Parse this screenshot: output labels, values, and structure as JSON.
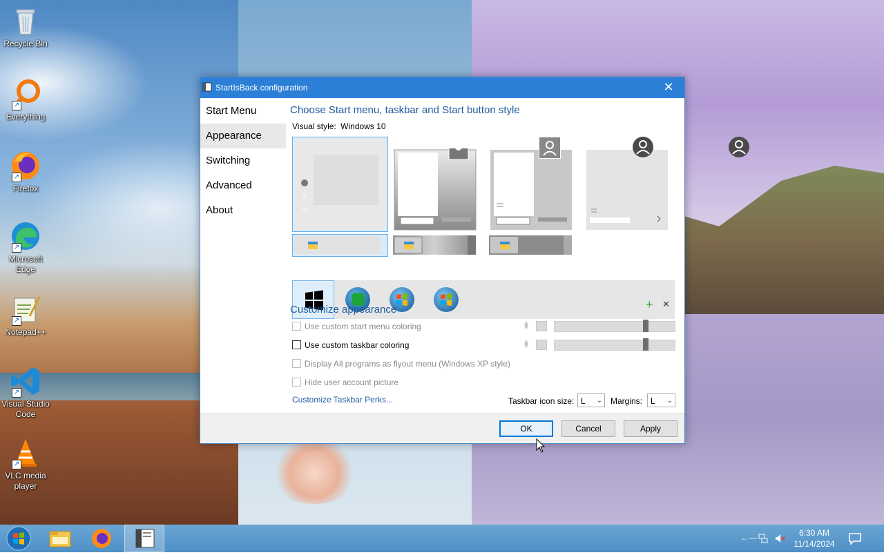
{
  "desktop": {
    "icons": [
      {
        "label": "Recycle Bin",
        "icon": "recycle-bin-icon"
      },
      {
        "label": "Everything",
        "icon": "everything-icon"
      },
      {
        "label": "Firefox",
        "icon": "firefox-icon"
      },
      {
        "label": "Microsoft Edge",
        "icon": "edge-icon"
      },
      {
        "label": "Notepad++",
        "icon": "notepadpp-icon"
      },
      {
        "label": "Visual Studio Code",
        "icon": "vscode-icon"
      },
      {
        "label": "VLC media player",
        "icon": "vlc-icon"
      }
    ]
  },
  "dialog": {
    "title": "StartIsBack configuration",
    "close_glyph": "✕",
    "nav": [
      {
        "label": "Start Menu",
        "selected": false
      },
      {
        "label": "Appearance",
        "selected": true
      },
      {
        "label": "Switching",
        "selected": false
      },
      {
        "label": "Advanced",
        "selected": false
      },
      {
        "label": "About",
        "selected": false
      }
    ],
    "style_heading": "Choose Start menu, taskbar and Start button style",
    "visual_style_label": "Visual style:",
    "visual_style_value": "Windows 10",
    "customize_heading": "Customize appearance",
    "checkboxes": [
      {
        "label": "Use custom start menu coloring",
        "checked": false,
        "enabled": false
      },
      {
        "label": "Use custom taskbar coloring",
        "checked": false,
        "enabled": true
      },
      {
        "label": "Display All programs as flyout menu (Windows XP style)",
        "checked": false,
        "enabled": false
      },
      {
        "label": "Hide user account picture",
        "checked": false,
        "enabled": false
      }
    ],
    "perks_link": "Customize Taskbar Perks...",
    "icon_size_label": "Taskbar icon size:",
    "icon_size_value": "L",
    "margins_label": "Margins:",
    "margins_value": "L",
    "add_glyph": "+",
    "remove_glyph": "✕",
    "buttons": {
      "ok": "OK",
      "cancel": "Cancel",
      "apply": "Apply"
    },
    "accent_color": "#2b7fd6"
  },
  "taskbar": {
    "time": "6:30 AM",
    "date": "11/14/2024",
    "items": [
      "start-orb-icon",
      "file-explorer-icon",
      "firefox-icon",
      "startisback-config-icon"
    ]
  }
}
